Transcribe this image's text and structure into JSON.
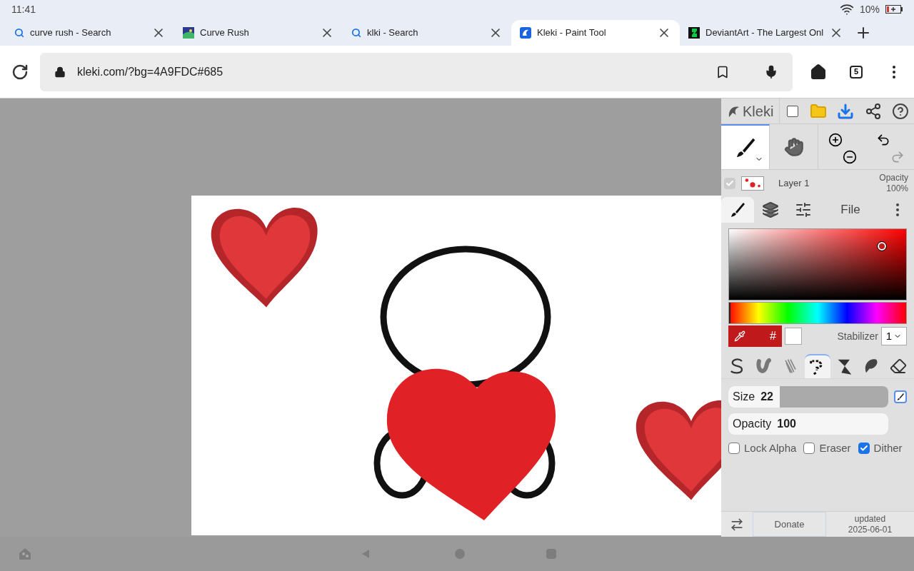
{
  "status_bar": {
    "time": "11:41",
    "battery": "10%"
  },
  "tabs": [
    {
      "title": "curve rush - Search",
      "kind": "search",
      "selected": false
    },
    {
      "title": "Curve Rush",
      "kind": "game",
      "selected": false
    },
    {
      "title": "klki - Search",
      "kind": "search",
      "selected": false
    },
    {
      "title": "Kleki - Paint Tool",
      "kind": "kleki",
      "selected": true
    },
    {
      "title": "DeviantArt - The Largest Onl",
      "kind": "deviantart",
      "selected": false
    }
  ],
  "address_bar": {
    "url": "kleki.com/?bg=4A9FDC#685",
    "tab_count": "5"
  },
  "kleki": {
    "brand": "Kleki",
    "tools": [
      {
        "kind": "brush",
        "selected": true
      },
      {
        "kind": "hand",
        "selected": false
      }
    ],
    "layer": {
      "name": "Layer 1",
      "visible": true,
      "opacity_label": "Opacity",
      "opacity": "100%"
    },
    "panel_tabs": [
      {
        "kind": "brush",
        "selected": true
      },
      {
        "kind": "layers",
        "selected": false
      },
      {
        "kind": "adjust",
        "selected": false
      },
      {
        "kind": "text",
        "label": "File",
        "selected": false
      },
      {
        "kind": "more",
        "selected": false
      }
    ],
    "hue": {
      "level": 0
    },
    "hex_label": "#",
    "stabilizer_label": "Stabilizer",
    "stabilizer": "1",
    "brushes": [
      {
        "kind": "pen",
        "selected": false
      },
      {
        "kind": "blend",
        "selected": false
      },
      {
        "kind": "sketchy",
        "selected": false
      },
      {
        "kind": "pixel",
        "selected": true
      },
      {
        "kind": "chemy",
        "selected": false
      },
      {
        "kind": "smudge",
        "selected": false
      },
      {
        "kind": "eraser",
        "selected": false
      }
    ],
    "sliders": [
      {
        "label": "Size",
        "value": "22",
        "level": 0.32
      },
      {
        "label": "Opacity",
        "value": "100",
        "level": 1
      }
    ],
    "options": [
      {
        "label": "Lock Alpha",
        "checked": false
      },
      {
        "label": "Eraser",
        "checked": false
      },
      {
        "label": "Dither",
        "checked": true
      }
    ],
    "footer": {
      "donate": "Donate",
      "updated": "updated",
      "date": "2025-06-01"
    }
  }
}
